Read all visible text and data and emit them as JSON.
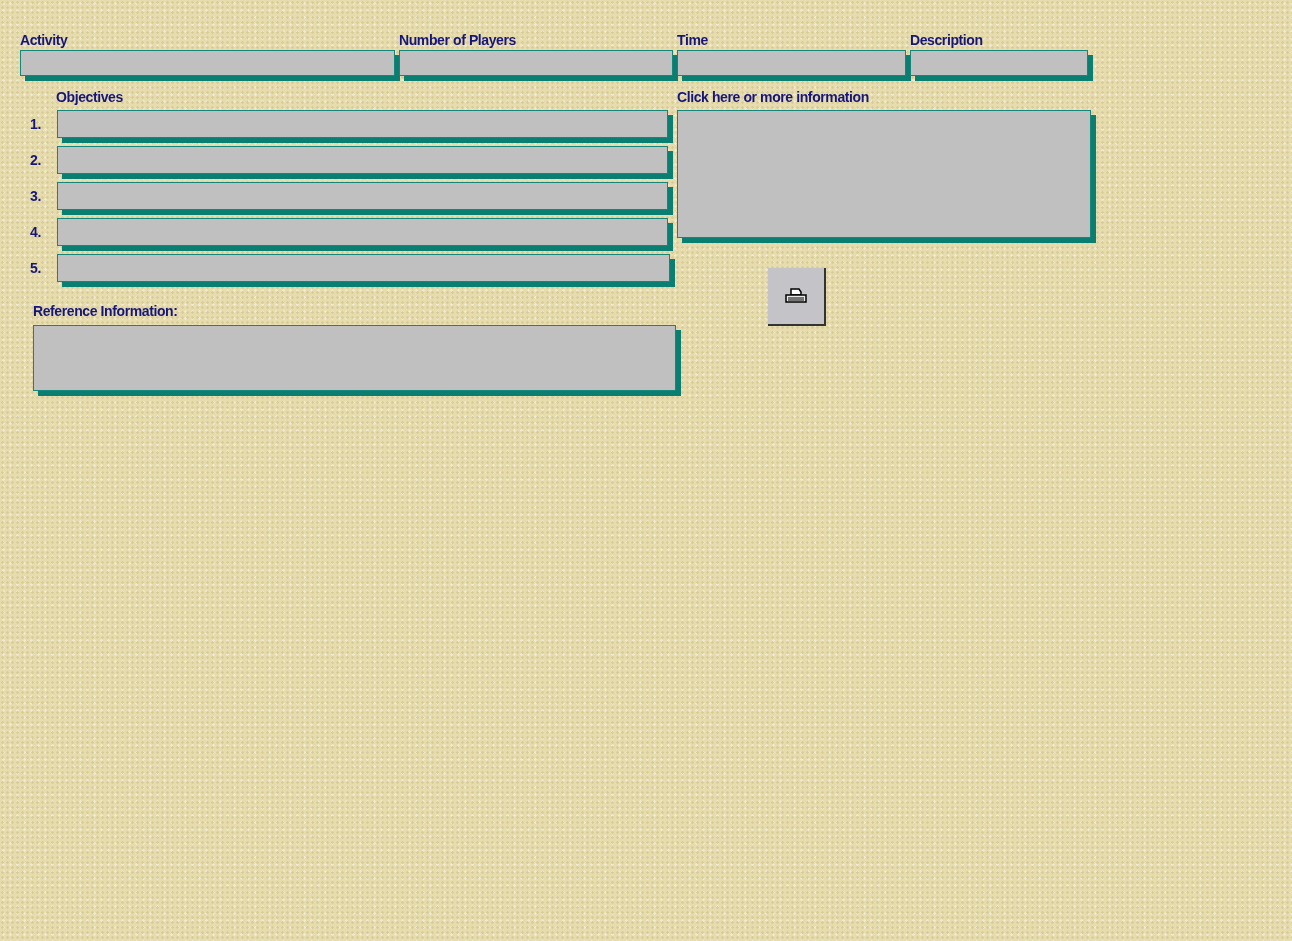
{
  "header_fields": [
    {
      "label": "Activity"
    },
    {
      "label": "Number of Players"
    },
    {
      "label": "Time"
    },
    {
      "label": "Description"
    }
  ],
  "objectives": {
    "label": "Objectives",
    "items": [
      {
        "number": "1."
      },
      {
        "number": "2."
      },
      {
        "number": "3."
      },
      {
        "number": "4."
      },
      {
        "number": "5."
      }
    ]
  },
  "more_info": {
    "label": "Click here or more information"
  },
  "reference": {
    "label": "Reference Information:"
  }
}
